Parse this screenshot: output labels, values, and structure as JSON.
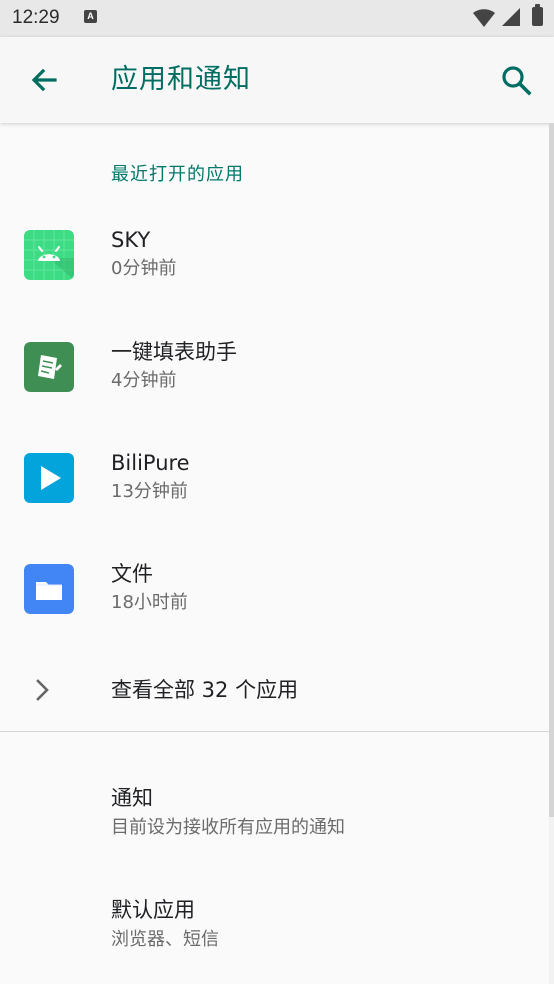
{
  "status_bar": {
    "time": "12:29",
    "notification_icon_text": "A",
    "icons": [
      "wifi-icon",
      "signal-icon",
      "battery-icon"
    ]
  },
  "app_bar": {
    "title": "应用和通知",
    "back_icon": "arrow-left-icon",
    "search_icon": "search-icon"
  },
  "recent_section": {
    "header": "最近打开的应用",
    "apps": [
      {
        "name": "SKY",
        "time": "0分钟前",
        "icon": "android-icon",
        "color": "#3ddc84"
      },
      {
        "name": "一键填表助手",
        "time": "4分钟前",
        "icon": "form-icon",
        "color": "#3f8f54"
      },
      {
        "name": "BiliPure",
        "time": "13分钟前",
        "icon": "play-icon",
        "color": "#03a3dc"
      },
      {
        "name": "文件",
        "time": "18小时前",
        "icon": "folder-icon",
        "color": "#4285f4"
      }
    ]
  },
  "view_all": {
    "label": "查看全部 32 个应用",
    "icon": "chevron-right-icon"
  },
  "settings": [
    {
      "title": "通知",
      "summary": "目前设为接收所有应用的通知"
    },
    {
      "title": "默认应用",
      "summary": "浏览器、短信"
    }
  ],
  "colors": {
    "accent": "#00796b",
    "title": "#006d62",
    "background": "#fafafa",
    "status_bar": "#e8e8e8",
    "secondary_text": "#6b6b6b"
  }
}
